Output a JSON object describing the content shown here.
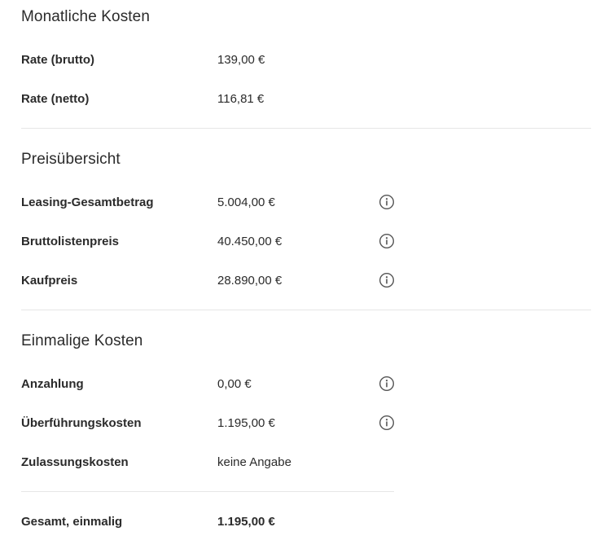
{
  "monthly": {
    "title": "Monatliche Kosten",
    "rows": [
      {
        "label": "Rate (brutto)",
        "value": "139,00 €"
      },
      {
        "label": "Rate (netto)",
        "value": "116,81 €"
      }
    ]
  },
  "price_overview": {
    "title": "Preisübersicht",
    "rows": [
      {
        "label": "Leasing-Gesamtbetrag",
        "value": "5.004,00 €",
        "icon": "info-icon"
      },
      {
        "label": "Bruttolistenpreis",
        "value": "40.450,00 €",
        "icon": "info-icon"
      },
      {
        "label": "Kaufpreis",
        "value": "28.890,00 €",
        "icon": "info-icon"
      }
    ]
  },
  "one_time": {
    "title": "Einmalige Kosten",
    "rows": [
      {
        "label": "Anzahlung",
        "value": "0,00 €",
        "icon": "info-icon"
      },
      {
        "label": "Überführungskosten",
        "value": "1.195,00 €",
        "icon": "info-icon"
      },
      {
        "label": "Zulassungskosten",
        "value": "keine Angabe"
      }
    ],
    "total": {
      "label": "Gesamt, einmalig",
      "value": "1.195,00 €"
    }
  },
  "colors": {
    "text": "#2b2b2b",
    "divider": "#e6e6e6",
    "icon": "#555555"
  }
}
